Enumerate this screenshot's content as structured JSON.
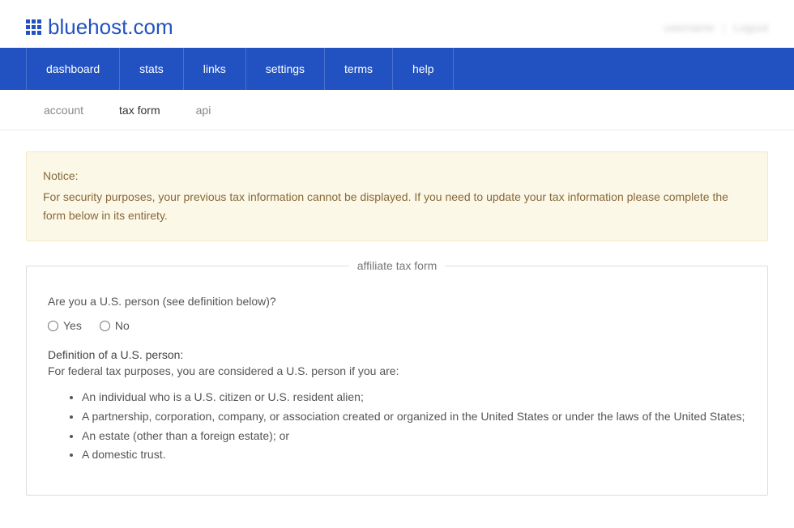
{
  "header": {
    "logo_text": "bluehost.com",
    "right_text_1": "username",
    "right_text_2": "Logout"
  },
  "primary_nav": {
    "items": [
      "dashboard",
      "stats",
      "links",
      "settings",
      "terms",
      "help"
    ]
  },
  "sub_nav": {
    "items": [
      {
        "label": "account",
        "active": false
      },
      {
        "label": "tax form",
        "active": true
      },
      {
        "label": "api",
        "active": false
      }
    ]
  },
  "notice": {
    "title": "Notice:",
    "body": "For security purposes, your previous tax information cannot be displayed. If you need to update your tax information please complete the form below in its entirety."
  },
  "form": {
    "legend": "affiliate tax form",
    "question": "Are you a U.S. person (see definition below)?",
    "option_yes": "Yes",
    "option_no": "No",
    "definition_title": "Definition of a U.S. person:",
    "definition_intro": "For federal tax purposes, you are considered a U.S. person if you are:",
    "definition_items": [
      "An individual who is a U.S. citizen or U.S. resident alien;",
      "A partnership, corporation, company, or association created or organized in the United States or under the laws of the United States;",
      "An estate (other than a foreign estate); or",
      "A domestic trust."
    ]
  }
}
